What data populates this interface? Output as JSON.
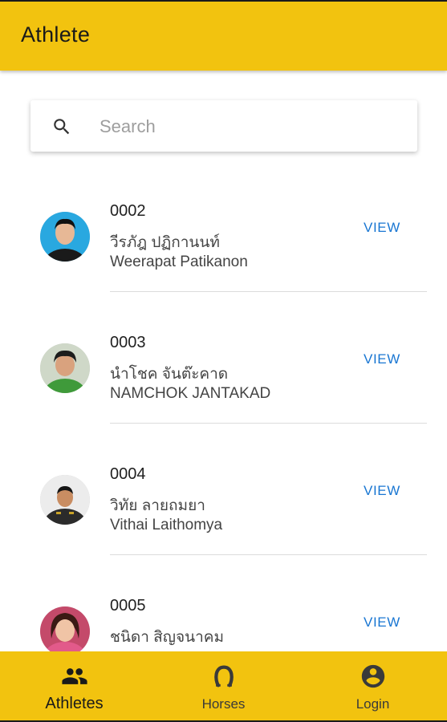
{
  "app": {
    "title": "Athlete"
  },
  "search": {
    "placeholder": "Search"
  },
  "actions": {
    "view_label": "VIEW"
  },
  "athletes": [
    {
      "code": "0002",
      "name_th": "วีรภัฎ ปฏิกานนท์",
      "name_en": "Weerapat Patikanon"
    },
    {
      "code": "0003",
      "name_th": "นำโชค จันต๊ะคาด",
      "name_en": "NAMCHOK JANTAKAD"
    },
    {
      "code": "0004",
      "name_th": "วิทัย ลายถมยา",
      "name_en": "Vithai Laithomya"
    },
    {
      "code": "0005",
      "name_th": "ชนิดา สิญจนาคม",
      "name_en": ""
    }
  ],
  "bottom_nav": [
    {
      "label": "Athletes",
      "icon": "people-icon",
      "active": true
    },
    {
      "label": "Horses",
      "icon": "horseshoe-icon",
      "active": false
    },
    {
      "label": "Login",
      "icon": "account-circle-icon",
      "active": false
    }
  ],
  "colors": {
    "accent": "#f2c30f",
    "link": "#1976d2"
  }
}
